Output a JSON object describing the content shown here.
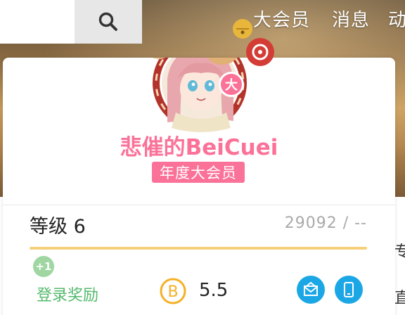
{
  "nav": {
    "items": [
      "大会员",
      "消息",
      "动"
    ]
  },
  "side": {
    "text_1": "专",
    "text_2": "直"
  },
  "profile": {
    "username": "悲催的BeiCuei",
    "vip_label": "年度大会员",
    "avatar_badge": "大"
  },
  "level": {
    "label": "等级 6",
    "exp": "29092 / --",
    "progress_fraction": 1.0
  },
  "reward": {
    "plus_one": "+1",
    "login_label": "登录奖励"
  },
  "coins": {
    "value": "5.5",
    "icon": "b-coin-icon"
  },
  "icons": [
    "search-icon",
    "mail-icon",
    "phone-icon"
  ],
  "colors": {
    "pink": "#fb7299",
    "green": "#53b96b",
    "blue": "#1ba7e6",
    "gold": "#f6cf7a"
  }
}
